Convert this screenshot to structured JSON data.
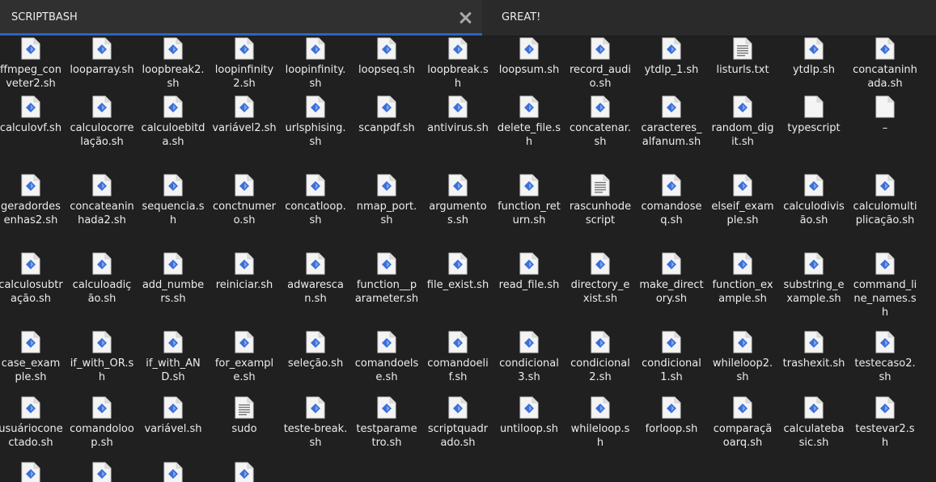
{
  "tabs": [
    {
      "label": "SCRIPTBASH",
      "active": true
    },
    {
      "label": "GREAT!",
      "active": false
    }
  ],
  "colors": {
    "accent": "#2c63c4",
    "script_icon": "#3a6fd8"
  },
  "files": [
    {
      "name": "ffmpeg_conveter2.sh",
      "type": "script"
    },
    {
      "name": "looparray.sh",
      "type": "script"
    },
    {
      "name": "loopbreak2.sh",
      "type": "script"
    },
    {
      "name": "loopinfinity2.sh",
      "type": "script"
    },
    {
      "name": "loopinfinity.sh",
      "type": "script"
    },
    {
      "name": "loopseq.sh",
      "type": "script"
    },
    {
      "name": "loopbreak.sh",
      "type": "script"
    },
    {
      "name": "loopsum.sh",
      "type": "script"
    },
    {
      "name": "record_audio.sh",
      "type": "script"
    },
    {
      "name": "ytdlp_1.sh",
      "type": "script"
    },
    {
      "name": "listurls.txt",
      "type": "text"
    },
    {
      "name": "ytdlp.sh",
      "type": "script"
    },
    {
      "name": "concataninhada.sh",
      "type": "script"
    },
    {
      "name": "calculovf.sh",
      "type": "script"
    },
    {
      "name": "calculocorrelação.sh",
      "type": "script"
    },
    {
      "name": "calculoebitda.sh",
      "type": "script"
    },
    {
      "name": "variável2.sh",
      "type": "script"
    },
    {
      "name": "urlsphising.sh",
      "type": "script"
    },
    {
      "name": "scanpdf.sh",
      "type": "script"
    },
    {
      "name": "antivirus.sh",
      "type": "script"
    },
    {
      "name": "delete_file.sh",
      "type": "script"
    },
    {
      "name": "concatenar.sh",
      "type": "script"
    },
    {
      "name": "caracteres_alfanum.sh",
      "type": "script"
    },
    {
      "name": "random_digit.sh",
      "type": "script"
    },
    {
      "name": "typescript",
      "type": "blank"
    },
    {
      "name": "–",
      "type": "blank"
    },
    {
      "name": "geradordesenhas2.sh",
      "type": "script"
    },
    {
      "name": "concateaninhada2.sh",
      "type": "script"
    },
    {
      "name": "sequencia.sh",
      "type": "script"
    },
    {
      "name": "conctnumero.sh",
      "type": "script"
    },
    {
      "name": "concatloop.sh",
      "type": "script"
    },
    {
      "name": "nmap_port.sh",
      "type": "script"
    },
    {
      "name": "argumentos.sh",
      "type": "script"
    },
    {
      "name": "function_return.sh",
      "type": "script"
    },
    {
      "name": "rascunhodescript",
      "type": "text"
    },
    {
      "name": "comandoseq.sh",
      "type": "script"
    },
    {
      "name": "elseif_example.sh",
      "type": "script"
    },
    {
      "name": "calculodivisão.sh",
      "type": "script"
    },
    {
      "name": "calculomultiplicação.sh",
      "type": "script"
    },
    {
      "name": "calculosubtração.sh",
      "type": "script"
    },
    {
      "name": "calculoadição.sh",
      "type": "script"
    },
    {
      "name": "add_numbers.sh",
      "type": "script"
    },
    {
      "name": "reiniciar.sh",
      "type": "script"
    },
    {
      "name": "adwarescan.sh",
      "type": "script"
    },
    {
      "name": "function__parameter.sh",
      "type": "script"
    },
    {
      "name": "file_exist.sh",
      "type": "script"
    },
    {
      "name": "read_file.sh",
      "type": "script"
    },
    {
      "name": "directory_exist.sh",
      "type": "script"
    },
    {
      "name": "make_directory.sh",
      "type": "script"
    },
    {
      "name": "function_example.sh",
      "type": "script"
    },
    {
      "name": "substring_example.sh",
      "type": "script"
    },
    {
      "name": "command_line_names.sh",
      "type": "script"
    },
    {
      "name": "case_example.sh",
      "type": "script"
    },
    {
      "name": "if_with_OR.sh",
      "type": "script"
    },
    {
      "name": "if_with_AND.sh",
      "type": "script"
    },
    {
      "name": "for_example.sh",
      "type": "script"
    },
    {
      "name": "seleção.sh",
      "type": "script"
    },
    {
      "name": "comandoelse.sh",
      "type": "script"
    },
    {
      "name": "comandoelif.sh",
      "type": "script"
    },
    {
      "name": "condicional3.sh",
      "type": "script"
    },
    {
      "name": "condicional2.sh",
      "type": "script"
    },
    {
      "name": "condicional1.sh",
      "type": "script"
    },
    {
      "name": "whileloop2.sh",
      "type": "script"
    },
    {
      "name": "trashexit.sh",
      "type": "script"
    },
    {
      "name": "testecaso2.sh",
      "type": "script"
    },
    {
      "name": "usuárioconectado.sh",
      "type": "script"
    },
    {
      "name": "comandoloop.sh",
      "type": "script"
    },
    {
      "name": "variável.sh",
      "type": "script"
    },
    {
      "name": "sudo",
      "type": "text"
    },
    {
      "name": "teste-break.sh",
      "type": "script"
    },
    {
      "name": "testparametro.sh",
      "type": "script"
    },
    {
      "name": "scriptquadrado.sh",
      "type": "script"
    },
    {
      "name": "untiloop.sh",
      "type": "script"
    },
    {
      "name": "whileloop.sh",
      "type": "script"
    },
    {
      "name": "forloop.sh",
      "type": "script"
    },
    {
      "name": "comparaçãoarq.sh",
      "type": "script"
    },
    {
      "name": "calculatebasic.sh",
      "type": "script"
    },
    {
      "name": "testevar2.sh",
      "type": "script"
    },
    {
      "name": "",
      "type": "script"
    },
    {
      "name": "",
      "type": "script"
    },
    {
      "name": "",
      "type": "script"
    },
    {
      "name": "",
      "type": "script"
    }
  ]
}
